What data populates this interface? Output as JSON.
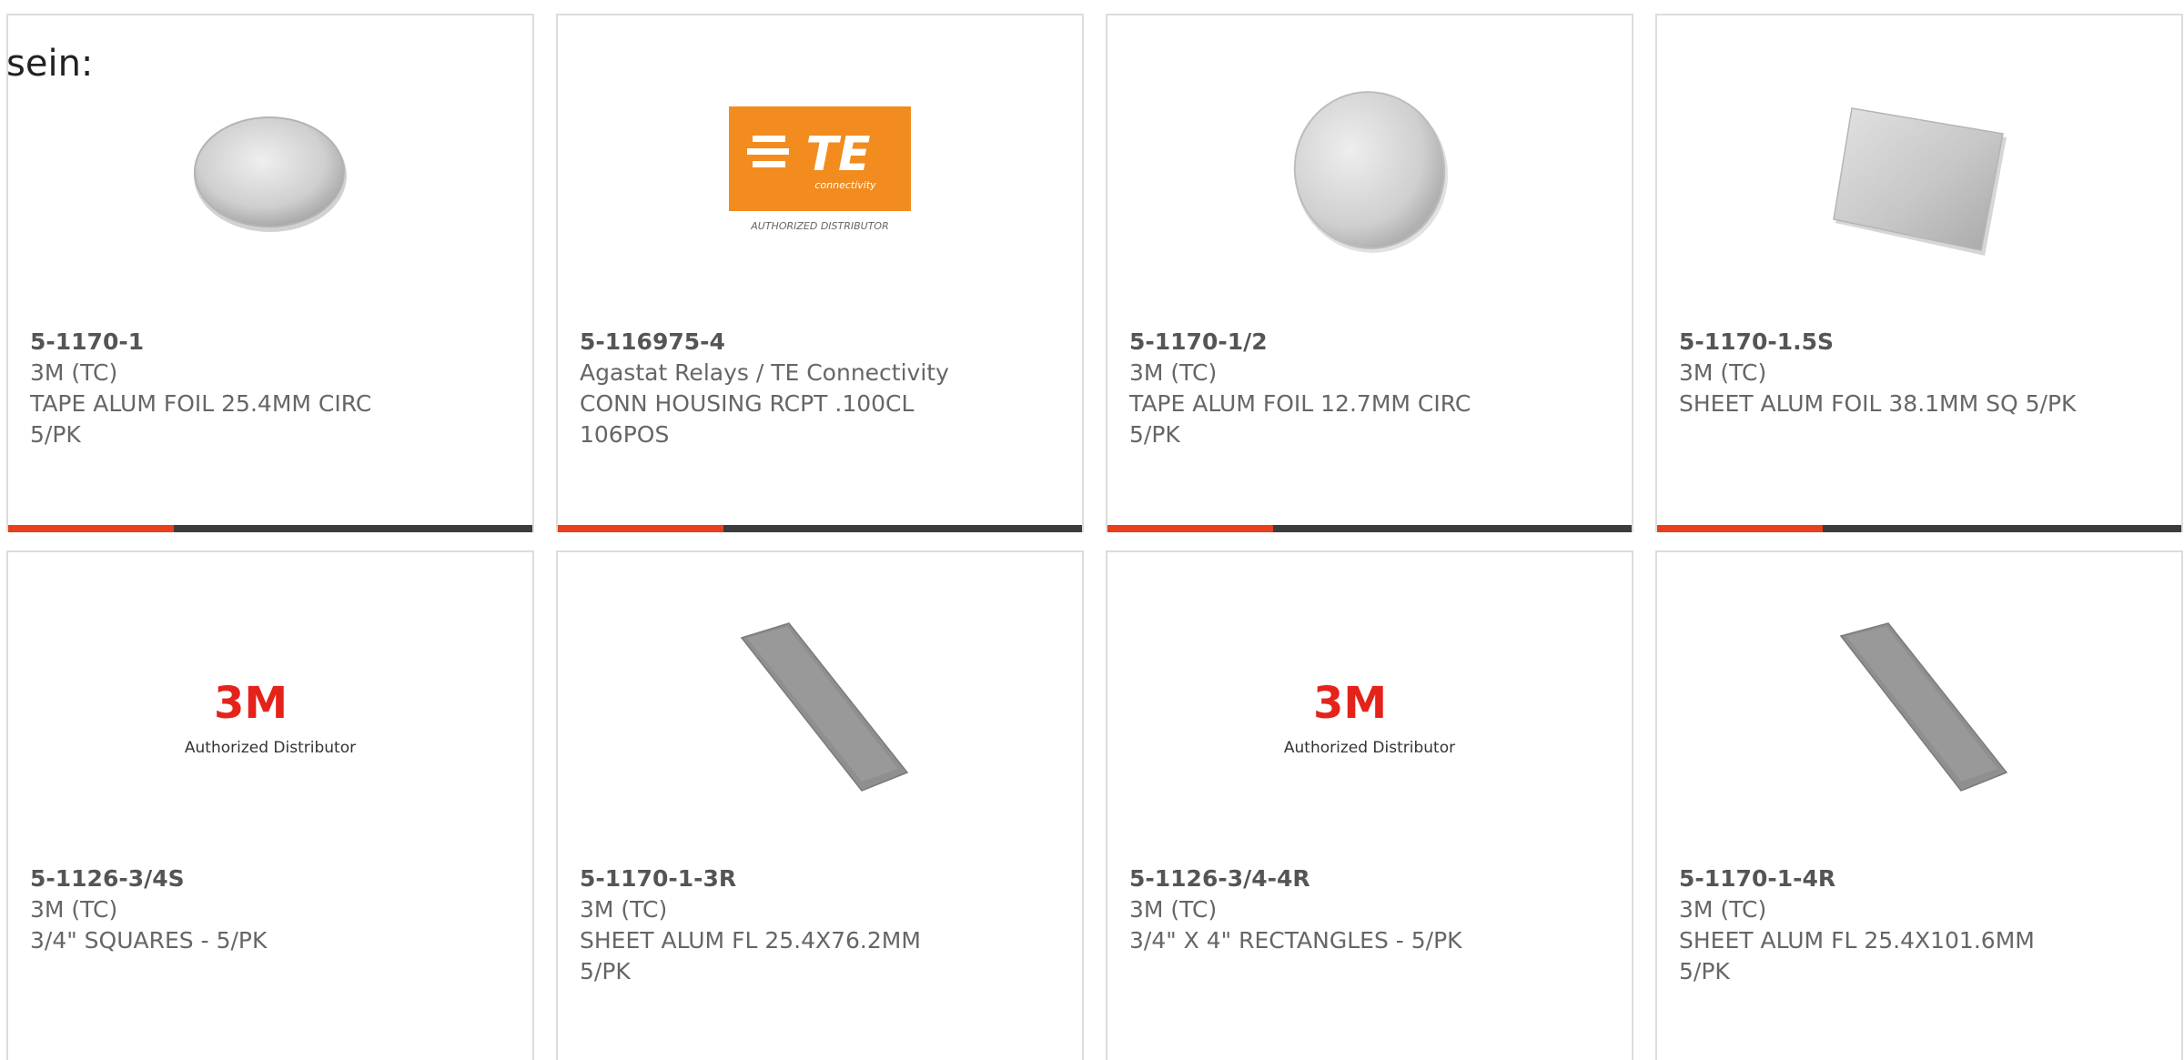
{
  "page": {
    "heading": "sein:"
  },
  "accent_color": "#e8401c",
  "products": [
    {
      "part_number": "5-1170-1",
      "manufacturer": "3M (TC)",
      "description": "TAPE ALUM FOIL 25.4MM CIRC 5/PK",
      "image": "aluminum-foil-disc-image"
    },
    {
      "part_number": "5-116975-4",
      "manufacturer": "Agastat Relays / TE Connectivity",
      "description": "CONN HOUSING RCPT .100CL 106POS",
      "image": "te-connectivity-logo",
      "logo": {
        "word": "TE",
        "subword": "connectivity",
        "caption": "AUTHORIZED DISTRIBUTOR",
        "color": "#f28c1e"
      }
    },
    {
      "part_number": "5-1170-1/2",
      "manufacturer": "3M (TC)",
      "description": "TAPE ALUM FOIL 12.7MM CIRC 5/PK",
      "image": "aluminum-foil-disc-image"
    },
    {
      "part_number": "5-1170-1.5S",
      "manufacturer": "3M (TC)",
      "description": "SHEET ALUM FOIL 38.1MM SQ 5/PK",
      "image": "aluminum-foil-square-image"
    },
    {
      "part_number": "5-1126-3/4S",
      "manufacturer": "3M (TC)",
      "description": "3/4\" SQUARES - 5/PK",
      "image": "3m-logo",
      "logo": {
        "word": "3M",
        "caption": "Authorized Distributor",
        "color": "#e4231b"
      }
    },
    {
      "part_number": "5-1170-1-3R",
      "manufacturer": "3M (TC)",
      "description": "SHEET ALUM FL 25.4X76.2MM 5/PK",
      "image": "aluminum-foil-strip-image"
    },
    {
      "part_number": "5-1126-3/4-4R",
      "manufacturer": "3M (TC)",
      "description": "3/4\" X 4\" RECTANGLES - 5/PK",
      "image": "3m-logo",
      "logo": {
        "word": "3M",
        "caption": "Authorized Distributor",
        "color": "#e4231b"
      }
    },
    {
      "part_number": "5-1170-1-4R",
      "manufacturer": "3M (TC)",
      "description": "SHEET ALUM FL 25.4X101.6MM 5/PK",
      "image": "aluminum-foil-strip-image"
    }
  ]
}
